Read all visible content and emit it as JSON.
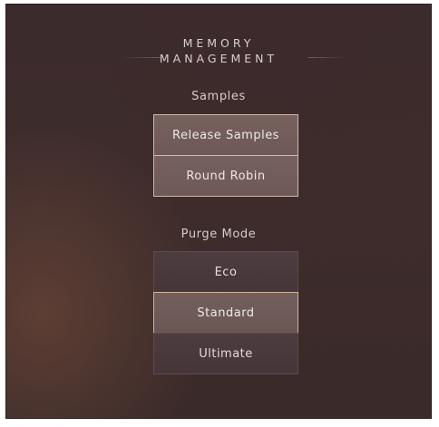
{
  "panel": {
    "title_line1": "MEMORY",
    "title_line2": "MANAGEMENT"
  },
  "samples": {
    "label": "Samples",
    "buttons": [
      {
        "label": "Release Samples",
        "active": true
      },
      {
        "label": "Round Robin",
        "active": true
      }
    ]
  },
  "purge_mode": {
    "label": "Purge Mode",
    "options": [
      {
        "label": "Eco",
        "selected": false
      },
      {
        "label": "Standard",
        "selected": true
      },
      {
        "label": "Ultimate",
        "selected": false
      }
    ],
    "selected": "Standard"
  },
  "colors": {
    "background": "#3c2b2d",
    "button_active": "#705b58",
    "button_inactive": "#4a3a3d",
    "accent_border": "#cfb59d",
    "text": "#e9e2de"
  }
}
